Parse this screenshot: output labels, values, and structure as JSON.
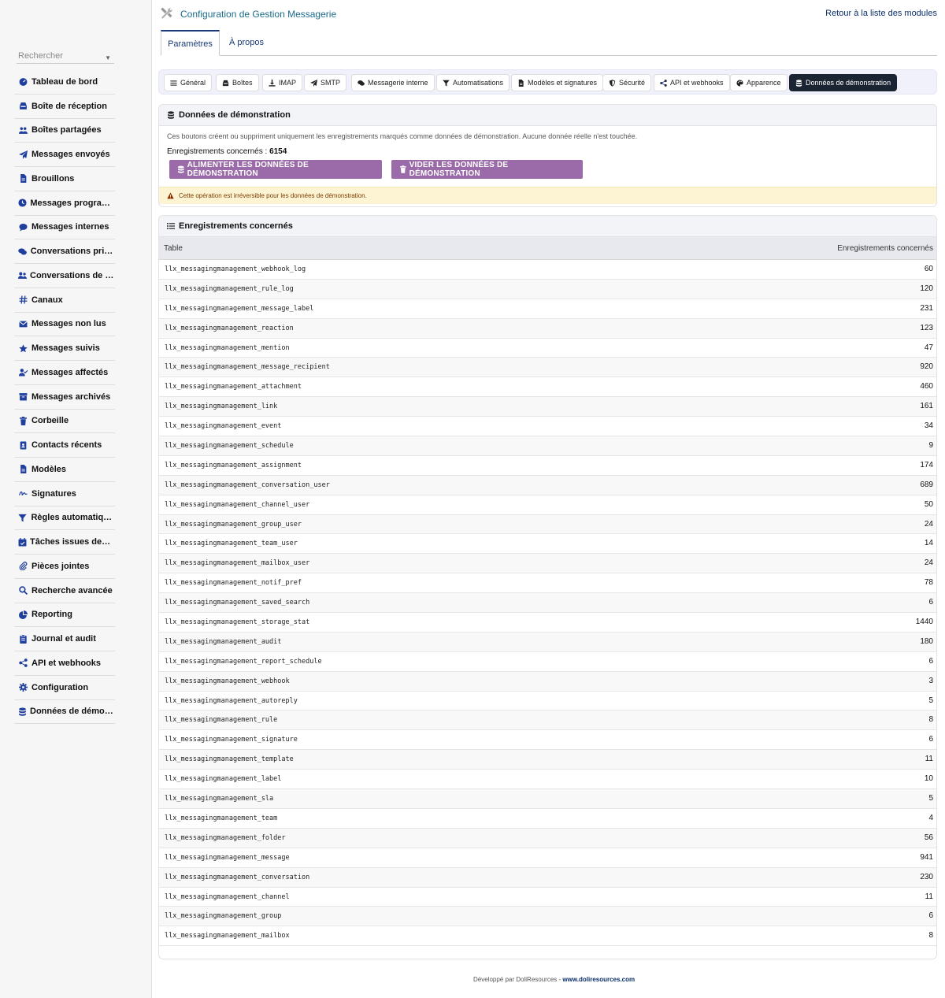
{
  "sidebar": {
    "search_placeholder": "Rechercher",
    "items": [
      {
        "label": "Tableau de bord",
        "icon": "dashboard-icon"
      },
      {
        "label": "Boîte de réception",
        "icon": "inbox-icon"
      },
      {
        "label": "Boîtes partagées",
        "icon": "users-icon"
      },
      {
        "label": "Messages envoyés",
        "icon": "paper-plane-icon"
      },
      {
        "label": "Brouillons",
        "icon": "file-icon"
      },
      {
        "label": "Messages programmés",
        "icon": "clock-icon"
      },
      {
        "label": "Messages internes",
        "icon": "comment-icon"
      },
      {
        "label": "Conversations privées",
        "icon": "comments-icon"
      },
      {
        "label": "Conversations de groupe",
        "icon": "user-group-icon"
      },
      {
        "label": "Canaux",
        "icon": "hashtag-icon"
      },
      {
        "label": "Messages non lus",
        "icon": "envelope-icon"
      },
      {
        "label": "Messages suivis",
        "icon": "star-icon"
      },
      {
        "label": "Messages affectés",
        "icon": "user-check-icon"
      },
      {
        "label": "Messages archivés",
        "icon": "archive-icon"
      },
      {
        "label": "Corbeille",
        "icon": "trash-icon"
      },
      {
        "label": "Contacts récents",
        "icon": "address-book-icon"
      },
      {
        "label": "Modèles",
        "icon": "file-icon"
      },
      {
        "label": "Signatures",
        "icon": "signature-icon"
      },
      {
        "label": "Règles automatiques",
        "icon": "filter-icon"
      },
      {
        "label": "Tâches issues des messages",
        "icon": "calendar-check-icon"
      },
      {
        "label": "Pièces jointes",
        "icon": "paperclip-icon"
      },
      {
        "label": "Recherche avancée",
        "icon": "search-icon"
      },
      {
        "label": "Reporting",
        "icon": "chart-pie-icon"
      },
      {
        "label": "Journal et audit",
        "icon": "clipboard-icon"
      },
      {
        "label": "API et webhooks",
        "icon": "share-icon"
      },
      {
        "label": "Configuration",
        "icon": "gear-icon"
      },
      {
        "label": "Données de démonstration",
        "icon": "database-icon"
      }
    ]
  },
  "header": {
    "title": "Configuration de Gestion Messagerie",
    "back_link": "Retour à la liste des modules"
  },
  "top_tabs": [
    "Paramètres",
    "À propos"
  ],
  "sub_tabs": [
    {
      "label": "Général",
      "icon": "bars-icon"
    },
    {
      "label": "Boîtes",
      "icon": "inbox-icon"
    },
    {
      "label": "IMAP",
      "icon": "download-icon"
    },
    {
      "label": "SMTP",
      "icon": "paper-plane-icon"
    },
    {
      "label": "Messagerie interne",
      "icon": "comments-icon"
    },
    {
      "label": "Automatisations",
      "icon": "filter-icon"
    },
    {
      "label": "Modèles et signatures",
      "icon": "file-icon"
    },
    {
      "label": "Sécurité",
      "icon": "shield-icon"
    },
    {
      "label": "API et webhooks",
      "icon": "share-icon"
    },
    {
      "label": "Apparence",
      "icon": "palette-icon"
    },
    {
      "label": "Données de démonstration",
      "icon": "database-icon"
    }
  ],
  "demo": {
    "title": "Données de démonstration",
    "description": "Ces boutons créent ou suppriment uniquement les enregistrements marqués comme données de démonstration. Aucune donnée réelle n'est touchée.",
    "count_label": "Enregistrements concernés :",
    "count_value": "6154",
    "seed_button": "ALIMENTER LES DONNÉES DE DÉMONSTRATION",
    "clear_button": "VIDER LES DONNÉES DE DÉMONSTRATION",
    "warning": "Cette opération est irréversible pour les données de démonstration."
  },
  "records": {
    "title": "Enregistrements concernés",
    "col_table": "Table",
    "col_count": "Enregistrements concernés",
    "rows": [
      [
        "llx_messagingmanagement_webhook_log",
        "60"
      ],
      [
        "llx_messagingmanagement_rule_log",
        "120"
      ],
      [
        "llx_messagingmanagement_message_label",
        "231"
      ],
      [
        "llx_messagingmanagement_reaction",
        "123"
      ],
      [
        "llx_messagingmanagement_mention",
        "47"
      ],
      [
        "llx_messagingmanagement_message_recipient",
        "920"
      ],
      [
        "llx_messagingmanagement_attachment",
        "460"
      ],
      [
        "llx_messagingmanagement_link",
        "161"
      ],
      [
        "llx_messagingmanagement_event",
        "34"
      ],
      [
        "llx_messagingmanagement_schedule",
        "9"
      ],
      [
        "llx_messagingmanagement_assignment",
        "174"
      ],
      [
        "llx_messagingmanagement_conversation_user",
        "689"
      ],
      [
        "llx_messagingmanagement_channel_user",
        "50"
      ],
      [
        "llx_messagingmanagement_group_user",
        "24"
      ],
      [
        "llx_messagingmanagement_team_user",
        "14"
      ],
      [
        "llx_messagingmanagement_mailbox_user",
        "24"
      ],
      [
        "llx_messagingmanagement_notif_pref",
        "78"
      ],
      [
        "llx_messagingmanagement_saved_search",
        "6"
      ],
      [
        "llx_messagingmanagement_storage_stat",
        "1440"
      ],
      [
        "llx_messagingmanagement_audit",
        "180"
      ],
      [
        "llx_messagingmanagement_report_schedule",
        "6"
      ],
      [
        "llx_messagingmanagement_webhook",
        "3"
      ],
      [
        "llx_messagingmanagement_autoreply",
        "5"
      ],
      [
        "llx_messagingmanagement_rule",
        "8"
      ],
      [
        "llx_messagingmanagement_signature",
        "6"
      ],
      [
        "llx_messagingmanagement_template",
        "11"
      ],
      [
        "llx_messagingmanagement_label",
        "10"
      ],
      [
        "llx_messagingmanagement_sla",
        "5"
      ],
      [
        "llx_messagingmanagement_team",
        "4"
      ],
      [
        "llx_messagingmanagement_folder",
        "56"
      ],
      [
        "llx_messagingmanagement_message",
        "941"
      ],
      [
        "llx_messagingmanagement_conversation",
        "230"
      ],
      [
        "llx_messagingmanagement_channel",
        "11"
      ],
      [
        "llx_messagingmanagement_group",
        "6"
      ],
      [
        "llx_messagingmanagement_mailbox",
        "8"
      ]
    ]
  },
  "footer": {
    "text": "Développé par DoliResources - ",
    "link": "www.doliresources.com"
  },
  "colors": {
    "accent": "#1a3a7a",
    "button": "#9b6aa9",
    "active_subtab": "#1b2432",
    "warning_bg": "#fdf4d3",
    "icon": "#1f3f9f"
  }
}
